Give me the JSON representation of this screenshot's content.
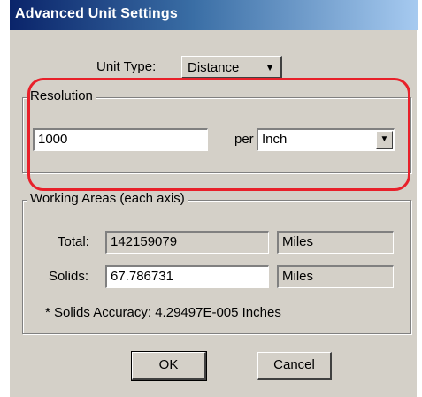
{
  "window": {
    "title": "Advanced Unit Settings"
  },
  "unit_type": {
    "label": "Unit Type:",
    "value": "Distance"
  },
  "resolution": {
    "group_title": "Resolution",
    "value": "1000",
    "per_label": "per",
    "unit_value": "Inch"
  },
  "working_areas": {
    "group_title": "Working Areas (each axis)",
    "total_label": "Total:",
    "total_value": "142159079",
    "total_unit": "Miles",
    "solids_label": "Solids:",
    "solids_value": "67.786731",
    "solids_unit": "Miles",
    "accuracy_text": "* Solids Accuracy: 4.29497E-005 Inches"
  },
  "buttons": {
    "ok_label": "OK",
    "cancel_label": "Cancel"
  },
  "colors": {
    "highlight": "#e8202a",
    "titlebar_start": "#0a246a",
    "dialog_bg": "#d4d0c8"
  }
}
